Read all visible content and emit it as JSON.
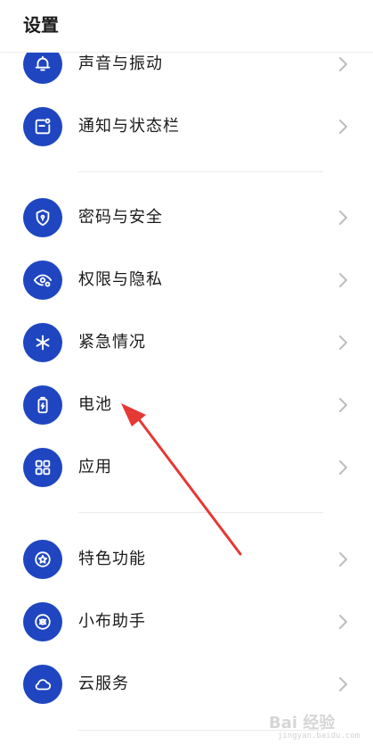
{
  "header": {
    "title": "设置"
  },
  "items": [
    {
      "label": "声音与振动",
      "icon": "bell-icon"
    },
    {
      "label": "通知与状态栏",
      "icon": "notification-icon"
    },
    {
      "label": "密码与安全",
      "icon": "shield-lock-icon"
    },
    {
      "label": "权限与隐私",
      "icon": "eye-privacy-icon"
    },
    {
      "label": "紧急情况",
      "icon": "asterisk-emergency-icon"
    },
    {
      "label": "电池",
      "icon": "battery-icon"
    },
    {
      "label": "应用",
      "icon": "apps-grid-icon"
    },
    {
      "label": "特色功能",
      "icon": "star-circle-icon"
    },
    {
      "label": "小布助手",
      "icon": "assistant-icon"
    },
    {
      "label": "云服务",
      "icon": "cloud-icon"
    }
  ],
  "colors": {
    "icon_bg": "#1f46c0",
    "arrow": "#e53935",
    "chevron": "#bdbdbd"
  },
  "watermark": {
    "text": "Bai 经验",
    "sub": "jingyan.baidu.com"
  }
}
